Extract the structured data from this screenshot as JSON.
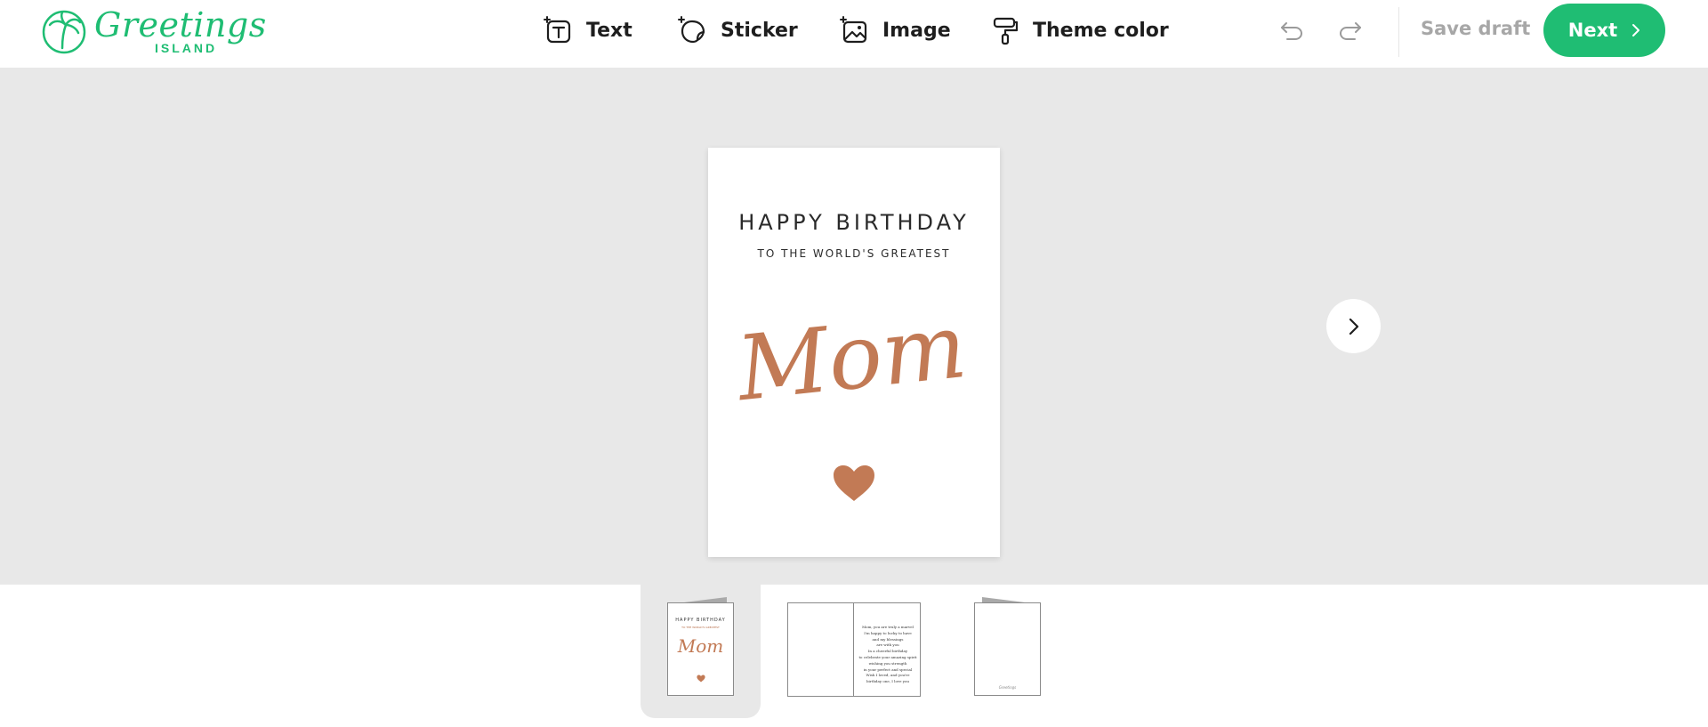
{
  "brand": {
    "name": "Greetings",
    "sub": "ISLAND",
    "color": "#1fbd73"
  },
  "toolbar": {
    "text_label": "Text",
    "sticker_label": "Sticker",
    "image_label": "Image",
    "theme_color_label": "Theme color",
    "undo_icon": "undo-icon",
    "redo_icon": "redo-icon",
    "save_draft_label": "Save draft",
    "next_label": "Next"
  },
  "card": {
    "title": "HAPPY BIRTHDAY",
    "subtitle": "TO THE WORLD'S GREATEST",
    "script": "Mom",
    "accent": "#c27a55"
  },
  "thumbnails": {
    "front": {
      "title": "HAPPY BIRTHDAY",
      "subtitle": "TO THE WORLD'S GREATEST",
      "script": "Mom"
    },
    "inside": {
      "verse": [
        "Mom, you are truly a marvel",
        "I'm happy to lucky to have",
        "and my blessings",
        "are with you",
        "In a cheerful birthday",
        "to celebrate your amazing spirit",
        "wishing you strength",
        "in your perfect and special",
        "Wish I loved, and you're",
        "birthday one, I love you"
      ]
    },
    "back": {
      "signature": "Greetings"
    }
  }
}
